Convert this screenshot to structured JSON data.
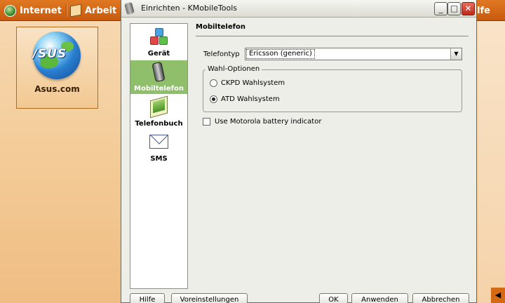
{
  "taskbar": {
    "items": [
      {
        "label": "Internet",
        "icon": "globe-icon"
      },
      {
        "label": "Arbeit",
        "icon": "briefcase-icon"
      },
      {
        "label": "lfe"
      }
    ]
  },
  "desktop": {
    "icon_logo_text": "/SUS",
    "icon_label": "Asus.com"
  },
  "dialog": {
    "title": "Einrichten - KMobileTools",
    "sidebar": [
      {
        "label": "Gerät",
        "icon": "devices-cubes-icon"
      },
      {
        "label": "Mobiltelefon",
        "icon": "mobile-phone-icon",
        "active": true
      },
      {
        "label": "Telefonbuch",
        "icon": "phonebook-icon"
      },
      {
        "label": "SMS",
        "icon": "envelope-icon"
      }
    ],
    "panel": {
      "title": "Mobiltelefon",
      "phone_type_label": "Telefontyp",
      "phone_type_value": "Ericsson (generic)",
      "dial_group_title": "Wahl-Optionen",
      "radio_ckpd": "CKPD Wahlsystem",
      "radio_atd": "ATD Wahlsystem",
      "radio_selected": "ATD Wahlsystem",
      "motorola_checkbox": "Use Motorola battery indicator",
      "motorola_checked": false
    },
    "buttons": {
      "help": "Hilfe",
      "defaults": "Voreinstellungen",
      "ok": "OK",
      "apply": "Anwenden",
      "cancel": "Abbrechen"
    }
  },
  "colors": {
    "taskbar": "#d46a18",
    "sidebar_active": "#8fbf6a",
    "dialog_bg": "#eeeee8"
  }
}
